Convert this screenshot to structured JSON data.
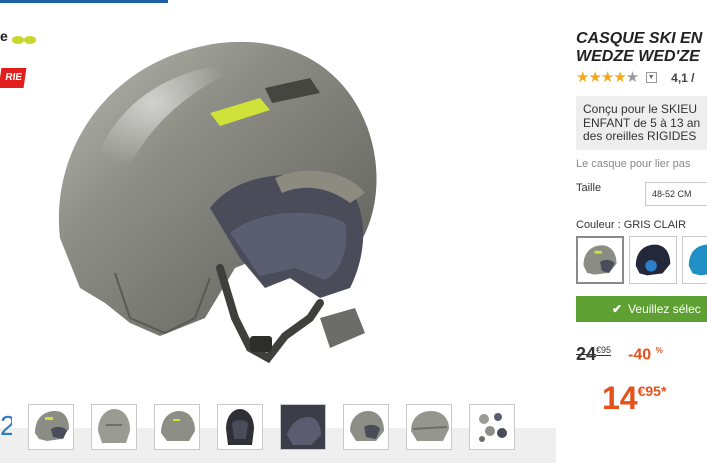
{
  "brand": {
    "badge_text": "RIE"
  },
  "product": {
    "title_line1": "CASQUE SKI EN",
    "title_line2": "WEDZE WED'ZE",
    "rating": {
      "stars_filled": 4,
      "stars_total": 5,
      "value": "4,1 /"
    },
    "description": [
      "Conçu pour le SKIEU",
      "ENFANT de 5 à 13 an",
      "des oreilles RIGIDES"
    ],
    "subtext": "Le casque pour lier pas",
    "size": {
      "label": "Taille",
      "selected": "48-52 CM"
    },
    "color": {
      "label": "Couleur : GRIS CLAIR"
    },
    "cta": {
      "label": "Veuillez sélec"
    },
    "price": {
      "old_main": "24",
      "old_cents": "€95",
      "discount": "-40",
      "discount_unit": "%",
      "new_main": "14",
      "new_cents": "€95*"
    }
  },
  "thumbnails": [
    "thumb-1",
    "thumb-2",
    "thumb-3",
    "thumb-4",
    "thumb-5",
    "thumb-6",
    "thumb-7",
    "thumb-8"
  ],
  "zoom_glyph": "2°",
  "colors": {
    "accent_green": "#5fa032",
    "price_orange": "#e4511b",
    "star": "#f2a91a",
    "badge_red": "#e1201e"
  }
}
